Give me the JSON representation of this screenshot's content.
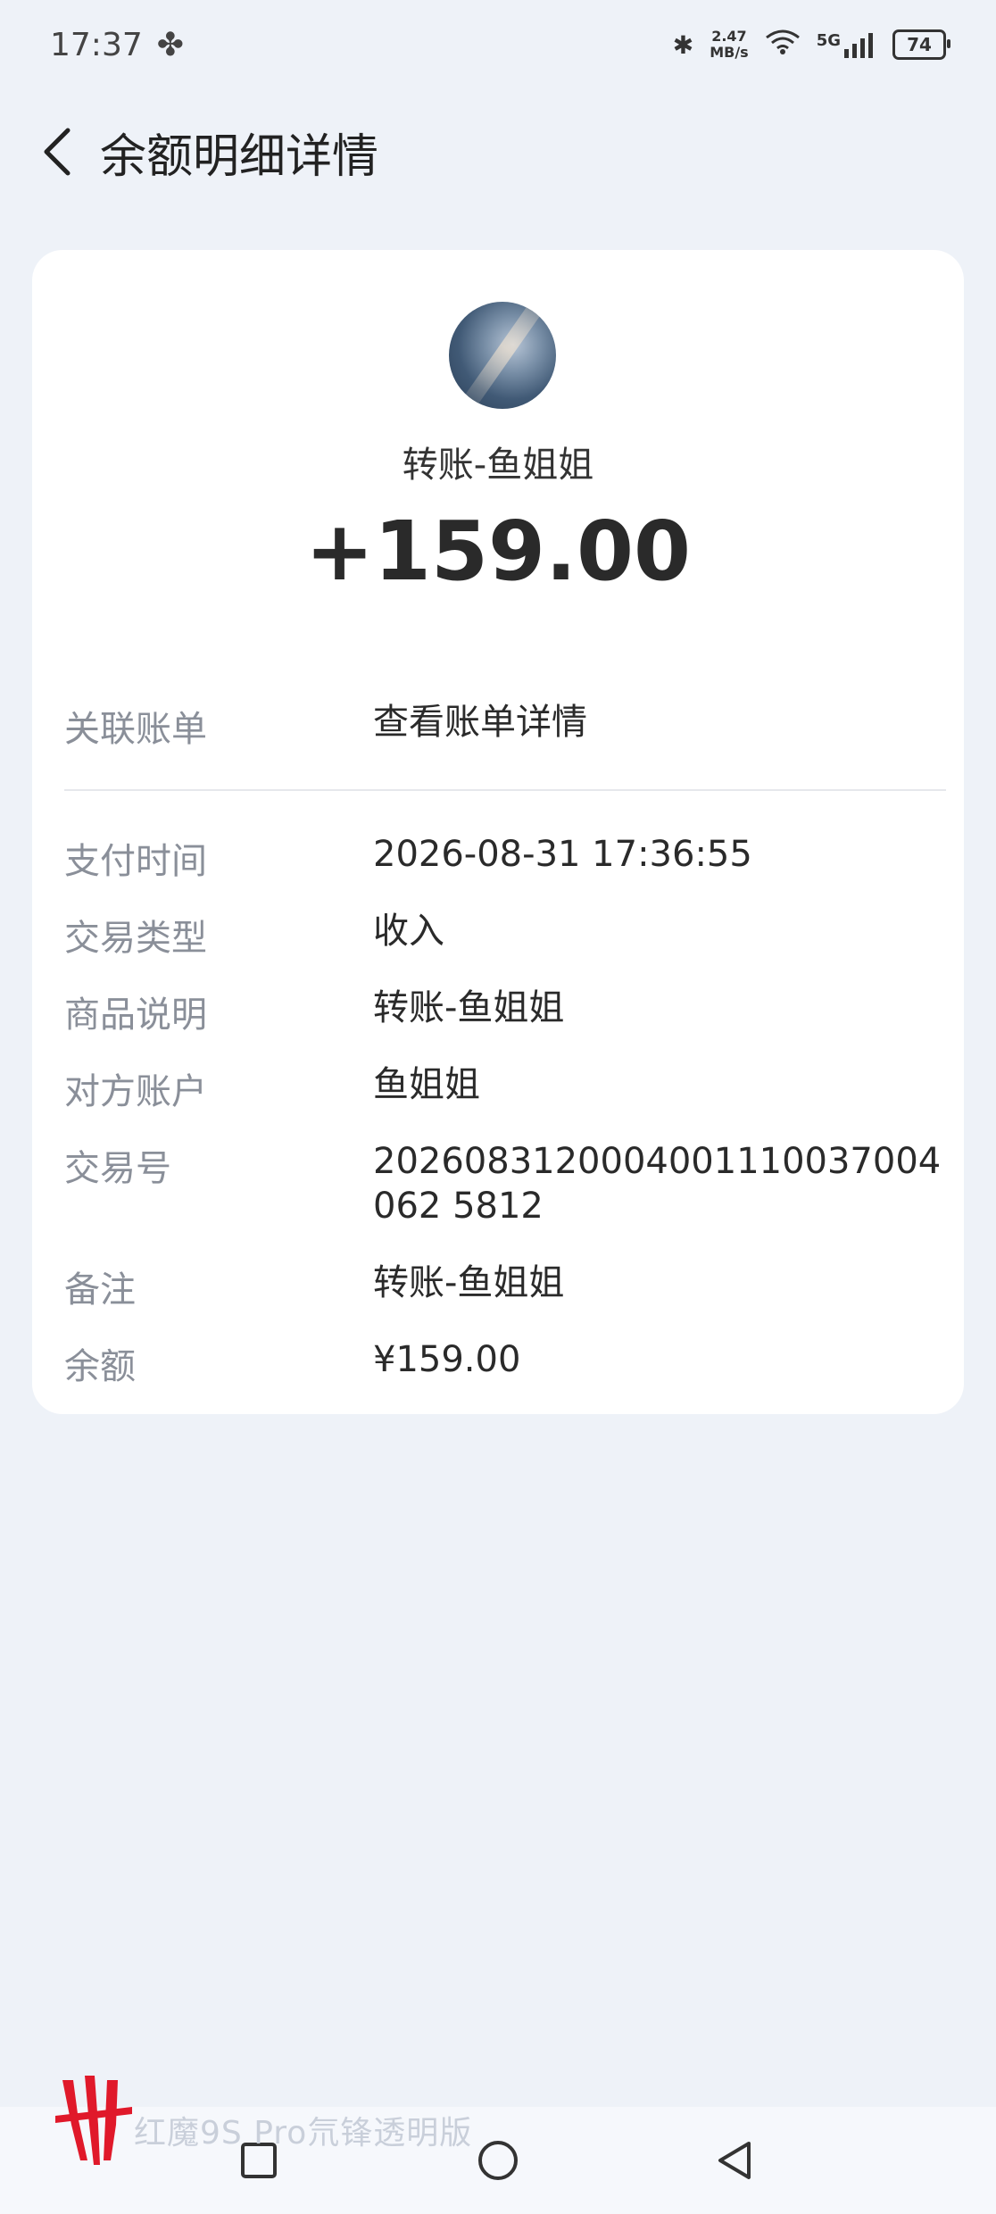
{
  "status": {
    "time": "17:37",
    "net_speed_value": "2.47",
    "net_speed_unit": "MB/s",
    "signal_label": "5G",
    "battery": "74"
  },
  "header": {
    "title": "余额明细详情"
  },
  "summary": {
    "payee": "转账-鱼姐姐",
    "amount": "+159.00"
  },
  "related_bill": {
    "label": "关联账单",
    "link_text": "查看账单详情"
  },
  "details": [
    {
      "label": "支付时间",
      "value": "2026-08-31 17:36:55"
    },
    {
      "label": "交易类型",
      "value": "收入"
    },
    {
      "label": "商品说明",
      "value": "转账-鱼姐姐"
    },
    {
      "label": "对方账户",
      "value": "鱼姐姐"
    },
    {
      "label": "交易号",
      "value": "2026083120004001110037004062 5812"
    },
    {
      "label": "备注",
      "value": "转账-鱼姐姐"
    },
    {
      "label": "余额",
      "value": "¥159.00"
    }
  ],
  "watermark": "红魔9S Pro氘锋透明版",
  "colors": {
    "background": "#eef2f8",
    "card": "#ffffff",
    "link": "#1f4f8c",
    "label": "#8a8f99",
    "brand_red": "#e0192a"
  }
}
